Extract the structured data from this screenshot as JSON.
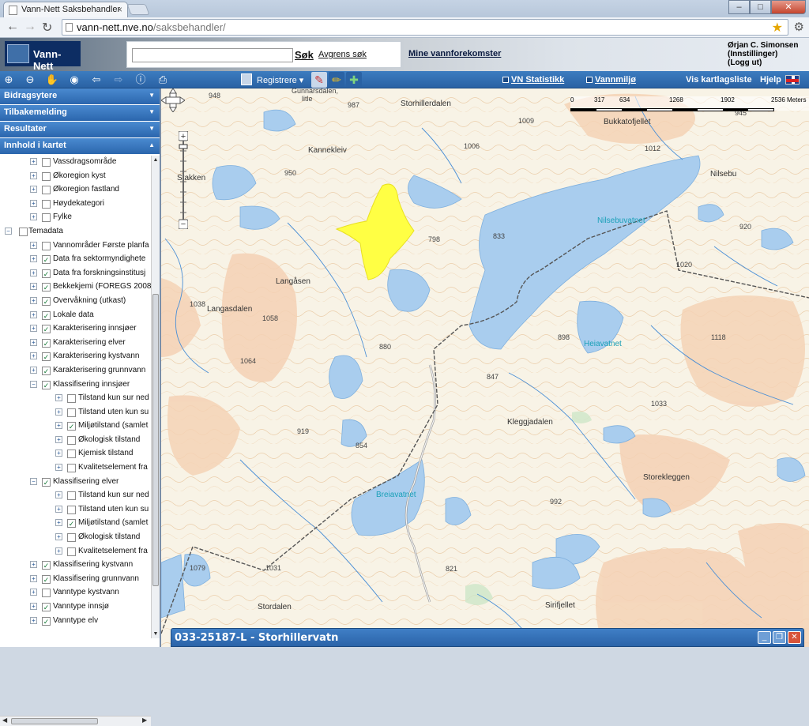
{
  "browser": {
    "tab_title": "Vann-Nett Saksbehandler",
    "tab_close": "×",
    "url_host": "vann-nett.nve.no",
    "url_path": "/saksbehandler/",
    "win_min": "–",
    "win_max": "□",
    "win_close": "✕"
  },
  "header": {
    "logo": "Vann-Nett",
    "search_placeholder": "",
    "search_button": "Søk",
    "refine_link": "Avgrens søk",
    "mine_link": "Mine vannforekomster",
    "user_name": "Ørjan C. Simonsen",
    "user_settings": "(Innstillinger)",
    "user_logout": "(Logg ut)"
  },
  "toolbar": {
    "registrere": "Registrere ▾",
    "vn_statistikk": "VN Statistikk",
    "vannmiljo": "Vannmiljø",
    "vis_kartlagsliste": "Vis kartlagsliste",
    "hjelp": "Hjelp",
    "icons": [
      "zoom-in-icon",
      "zoom-out-icon",
      "pan-hand-icon",
      "zoom-extent-icon",
      "back-arrow-icon",
      "forward-arrow-icon",
      "info-icon",
      "print-icon"
    ]
  },
  "sidebar": {
    "panels": [
      {
        "label": "Bidragsytere",
        "chev": "▼"
      },
      {
        "label": "Tilbakemelding",
        "chev": "▼"
      },
      {
        "label": "Resultater",
        "chev": "▼"
      },
      {
        "label": "Innhold i kartet",
        "chev": "▲"
      }
    ],
    "tree": [
      {
        "label": "Vassdragsområde",
        "level": 1,
        "exp": "+",
        "checked": false
      },
      {
        "label": "Økoregion kyst",
        "level": 1,
        "exp": "+",
        "checked": false
      },
      {
        "label": "Økoregion fastland",
        "level": 1,
        "exp": "+",
        "checked": false
      },
      {
        "label": "Høydekategori",
        "level": 1,
        "exp": "+",
        "checked": false
      },
      {
        "label": "Fylke",
        "level": 1,
        "exp": "+",
        "checked": false
      },
      {
        "label": "Temadata",
        "level": 0,
        "exp": "−",
        "checked": false
      },
      {
        "label": "Vannområder Første planfa",
        "level": 1,
        "exp": "+",
        "checked": false
      },
      {
        "label": "Data fra sektormyndighete",
        "level": 1,
        "exp": "+",
        "checked": true
      },
      {
        "label": "Data fra forskningsinstitusj",
        "level": 1,
        "exp": "+",
        "checked": true
      },
      {
        "label": "Bekkekjemi (FOREGS 2008",
        "level": 1,
        "exp": "+",
        "checked": true
      },
      {
        "label": "Overvåkning (utkast)",
        "level": 1,
        "exp": "+",
        "checked": true
      },
      {
        "label": "Lokale data",
        "level": 1,
        "exp": "+",
        "checked": true
      },
      {
        "label": "Karakterisering innsjøer",
        "level": 1,
        "exp": "+",
        "checked": true
      },
      {
        "label": "Karakterisering elver",
        "level": 1,
        "exp": "+",
        "checked": true
      },
      {
        "label": "Karakterisering kystvann",
        "level": 1,
        "exp": "+",
        "checked": true
      },
      {
        "label": "Karakterisering grunnvann",
        "level": 1,
        "exp": "+",
        "checked": true
      },
      {
        "label": "Klassifisering innsjøer",
        "level": 1,
        "exp": "−",
        "checked": true
      },
      {
        "label": "Tilstand kun sur ned",
        "level": 2,
        "exp": "+",
        "checked": false
      },
      {
        "label": "Tilstand uten kun su",
        "level": 2,
        "exp": "+",
        "checked": false
      },
      {
        "label": "Miljøtilstand (samlet",
        "level": 2,
        "exp": "+",
        "checked": true
      },
      {
        "label": "Økologisk tilstand",
        "level": 2,
        "exp": "+",
        "checked": false
      },
      {
        "label": "Kjemisk tilstand",
        "level": 2,
        "exp": "+",
        "checked": false
      },
      {
        "label": "Kvalitetselement fra",
        "level": 2,
        "exp": "+",
        "checked": false
      },
      {
        "label": "Klassifisering elver",
        "level": 1,
        "exp": "−",
        "checked": true
      },
      {
        "label": "Tilstand kun sur ned",
        "level": 2,
        "exp": "+",
        "checked": false
      },
      {
        "label": "Tilstand uten kun su",
        "level": 2,
        "exp": "+",
        "checked": false
      },
      {
        "label": "Miljøtilstand (samlet",
        "level": 2,
        "exp": "+",
        "checked": true
      },
      {
        "label": "Økologisk tilstand",
        "level": 2,
        "exp": "+",
        "checked": false
      },
      {
        "label": "Kvalitetselement fra",
        "level": 2,
        "exp": "+",
        "checked": false
      },
      {
        "label": "Klassifisering kystvann",
        "level": 1,
        "exp": "+",
        "checked": true
      },
      {
        "label": "Klassifisering grunnvann",
        "level": 1,
        "exp": "+",
        "checked": true
      },
      {
        "label": "Vanntype kystvann",
        "level": 1,
        "exp": "+",
        "checked": false
      },
      {
        "label": "Vanntype innsjø",
        "level": 1,
        "exp": "+",
        "checked": true
      },
      {
        "label": "Vanntype elv",
        "level": 1,
        "exp": "+",
        "checked": true
      }
    ]
  },
  "map": {
    "scale_ticks": [
      "0",
      "317",
      "634",
      "1268",
      "1902",
      "2536 Meters"
    ],
    "place_labels": [
      {
        "text": "948",
        "cls": ""
      },
      {
        "text": "Gunnarsdalen,",
        "cls": ""
      },
      {
        "text": "litle",
        "cls": ""
      },
      {
        "text": "987",
        "cls": ""
      },
      {
        "text": "Storhillerdalen",
        "cls": "big"
      },
      {
        "text": "Bukkatofjellet",
        "cls": "big"
      },
      {
        "text": "1009",
        "cls": ""
      },
      {
        "text": "945",
        "cls": ""
      },
      {
        "text": "1006",
        "cls": ""
      },
      {
        "text": "Kannekleiv",
        "cls": "big"
      },
      {
        "text": "1012",
        "cls": ""
      },
      {
        "text": "Nilsebu",
        "cls": "big"
      },
      {
        "text": "950",
        "cls": ""
      },
      {
        "text": "Stakken",
        "cls": "big"
      },
      {
        "text": "Nilsebuvatnet",
        "cls": "water"
      },
      {
        "text": "798",
        "cls": ""
      },
      {
        "text": "833",
        "cls": ""
      },
      {
        "text": "920",
        "cls": ""
      },
      {
        "text": "1020",
        "cls": ""
      },
      {
        "text": "1038",
        "cls": ""
      },
      {
        "text": "Langasdalen",
        "cls": "big"
      },
      {
        "text": "Langåsen",
        "cls": "big"
      },
      {
        "text": "1058",
        "cls": ""
      },
      {
        "text": "880",
        "cls": ""
      },
      {
        "text": "898",
        "cls": ""
      },
      {
        "text": "Heiavatnet",
        "cls": "water"
      },
      {
        "text": "1118",
        "cls": ""
      },
      {
        "text": "1064",
        "cls": ""
      },
      {
        "text": "847",
        "cls": ""
      },
      {
        "text": "1033",
        "cls": ""
      },
      {
        "text": "919",
        "cls": ""
      },
      {
        "text": "854",
        "cls": ""
      },
      {
        "text": "Kleggjadalen",
        "cls": "big"
      },
      {
        "text": "Storekleggen",
        "cls": "big"
      },
      {
        "text": "Breiavatnet",
        "cls": "water"
      },
      {
        "text": "992",
        "cls": ""
      },
      {
        "text": "1079",
        "cls": ""
      },
      {
        "text": "1031",
        "cls": ""
      },
      {
        "text": "821",
        "cls": ""
      },
      {
        "text": "Stordalen",
        "cls": "big"
      },
      {
        "text": "Sirifjellet",
        "cls": "big"
      }
    ]
  },
  "infobar": {
    "title": "033-25187-L - Storhillervatn",
    "min": "_",
    "restore": "❐",
    "close": "✕"
  },
  "colors": {
    "toolbar": "#2f6db5",
    "water": "#a9cdee",
    "land": "#f8f3e6",
    "highlight": "#ffff44",
    "high_terrain": "#f5d2b5"
  }
}
